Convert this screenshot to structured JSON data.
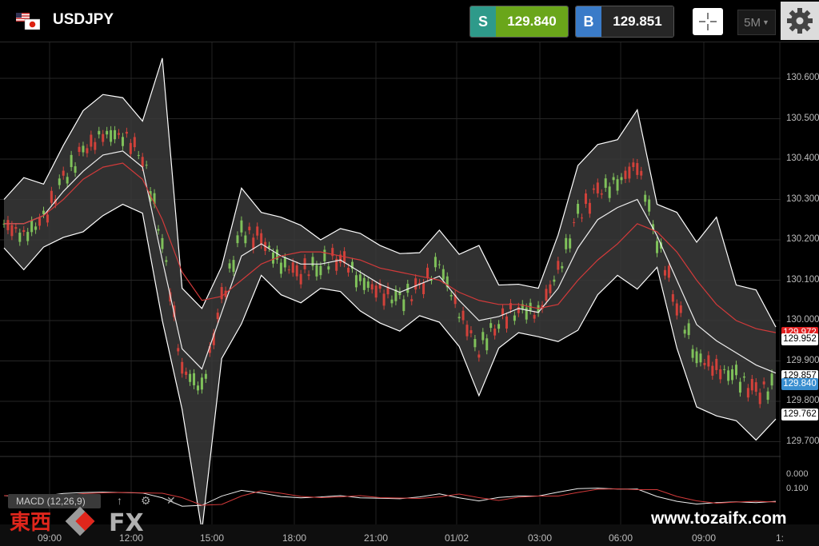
{
  "symbol": "USDJPY",
  "sell": {
    "label": "S",
    "price": "129.840"
  },
  "buy": {
    "label": "B",
    "price": "129.851"
  },
  "timeframe": "5M",
  "macd": {
    "label": "MACD (12,26,9)"
  },
  "price_axis": {
    "ticks": [
      "130.600",
      "130.500",
      "130.400",
      "130.300",
      "130.200",
      "130.100",
      "130.000",
      "129.900",
      "129.800",
      "129.700"
    ],
    "boxes": {
      "ma": "129.972",
      "band_upper": "129.952",
      "band_mid": "129.857",
      "current": "129.840",
      "band_lower": "129.762"
    }
  },
  "macd_axis": {
    "top": "0.000",
    "bottom": "0.100"
  },
  "time_axis": [
    "09:00",
    "12:00",
    "15:00",
    "18:00",
    "21:00",
    "01/02",
    "03:00",
    "06:00",
    "09:00",
    "1:"
  ],
  "watermark": {
    "logo_text_cn": "東西",
    "logo_text_fx": "FX",
    "url": "www.tozaifx.com"
  },
  "colors": {
    "sell_tag": "#2e9a8a",
    "sell_price": "#6aa61a",
    "buy_tag": "#3a7bc8",
    "ma": "#d23a3a",
    "band": "#ffffff",
    "current": "#3a8fd0"
  },
  "chart_data": {
    "type": "line",
    "title": "",
    "y_range": [
      129.65,
      130.7
    ],
    "x_ticks": [
      "09:00",
      "12:00",
      "15:00",
      "18:00",
      "21:00",
      "01/02",
      "03:00",
      "06:00",
      "09:00"
    ],
    "series": [
      {
        "values": [
          130.24,
          130.21,
          130.25,
          130.35,
          130.42,
          130.46,
          130.46,
          130.41,
          130.2,
          129.88,
          129.83,
          130.05,
          130.22,
          130.2,
          130.14,
          130.12,
          130.14,
          130.16,
          130.1,
          130.07,
          130.05,
          130.08,
          130.14,
          130.02,
          129.93,
          130.0,
          130.03,
          130.02,
          130.12,
          130.26,
          130.32,
          130.34,
          130.39,
          130.2,
          130.04,
          129.91,
          129.88,
          129.86,
          129.82,
          129.84
        ]
      },
      {
        "values": [
          130.24,
          130.24,
          130.26,
          130.32,
          130.37,
          130.41,
          130.42,
          130.38,
          130.15,
          129.93,
          129.88,
          130.02,
          130.16,
          130.19,
          130.16,
          130.14,
          130.14,
          130.15,
          130.12,
          130.09,
          130.07,
          130.09,
          130.11,
          130.05,
          130.0,
          130.01,
          130.03,
          130.02,
          130.08,
          130.18,
          130.25,
          130.28,
          130.3,
          130.21,
          130.1,
          129.99,
          129.95,
          129.92,
          129.89,
          129.87
        ]
      },
      {
        "values": [
          130.24,
          130.24,
          130.26,
          130.3,
          130.35,
          130.38,
          130.39,
          130.35,
          130.25,
          130.12,
          130.05,
          130.06,
          130.1,
          130.14,
          130.16,
          130.17,
          130.17,
          130.16,
          130.15,
          130.13,
          130.12,
          130.11,
          130.1,
          130.07,
          130.05,
          130.04,
          130.04,
          130.03,
          130.04,
          130.1,
          130.15,
          130.19,
          130.24,
          130.22,
          130.17,
          130.1,
          130.04,
          130.0,
          129.98,
          129.97
        ]
      }
    ]
  }
}
